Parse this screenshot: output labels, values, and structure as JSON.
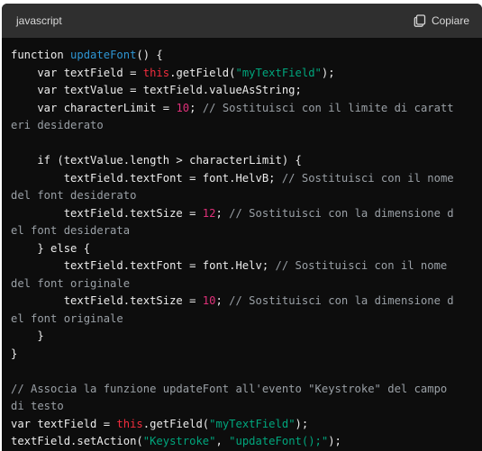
{
  "header": {
    "language": "javascript",
    "copy_label": "Copiare",
    "copy_icon": "clipboard-icon"
  },
  "colors": {
    "background": "#0d0d0d",
    "header_bg": "#2f2f2f",
    "plain": "#ececec",
    "function_name": "#2e95d3",
    "string": "#00a67d",
    "number": "#df3079",
    "comment": "#9aa0a6",
    "keyword_this": "#f22c3d"
  },
  "code_lines": [
    [
      [
        "plain",
        "function "
      ],
      [
        "fn",
        "updateFont"
      ],
      [
        "plain",
        "() {"
      ]
    ],
    [
      [
        "plain",
        "    var textField = "
      ],
      [
        "kw",
        "this"
      ],
      [
        "plain",
        ".getField("
      ],
      [
        "str",
        "\"myTextField\""
      ],
      [
        "plain",
        ");"
      ]
    ],
    [
      [
        "plain",
        "    var textValue = textField.valueAsString;"
      ]
    ],
    [
      [
        "plain",
        "    var characterLimit = "
      ],
      [
        "num",
        "10"
      ],
      [
        "plain",
        "; "
      ],
      [
        "com",
        "// Sostituisci con il limite di caratt"
      ]
    ],
    [
      [
        "com",
        "eri desiderato"
      ]
    ],
    [
      [
        "plain",
        ""
      ]
    ],
    [
      [
        "plain",
        "    if (textValue.length > characterLimit) {"
      ]
    ],
    [
      [
        "plain",
        "        textField.textFont = font.HelvB; "
      ],
      [
        "com",
        "// Sostituisci con il nome"
      ]
    ],
    [
      [
        "com",
        "del font desiderato"
      ]
    ],
    [
      [
        "plain",
        "        textField.textSize = "
      ],
      [
        "num",
        "12"
      ],
      [
        "plain",
        "; "
      ],
      [
        "com",
        "// Sostituisci con la dimensione d"
      ]
    ],
    [
      [
        "com",
        "el font desiderata"
      ]
    ],
    [
      [
        "plain",
        "    } else {"
      ]
    ],
    [
      [
        "plain",
        "        textField.textFont = font.Helv; "
      ],
      [
        "com",
        "// Sostituisci con il nome"
      ]
    ],
    [
      [
        "com",
        "del font originale"
      ]
    ],
    [
      [
        "plain",
        "        textField.textSize = "
      ],
      [
        "num",
        "10"
      ],
      [
        "plain",
        "; "
      ],
      [
        "com",
        "// Sostituisci con la dimensione d"
      ]
    ],
    [
      [
        "com",
        "el font originale"
      ]
    ],
    [
      [
        "plain",
        "    }"
      ]
    ],
    [
      [
        "plain",
        "}"
      ]
    ],
    [
      [
        "plain",
        ""
      ]
    ],
    [
      [
        "com",
        "// Associa la funzione updateFont all'evento \"Keystroke\" del campo"
      ]
    ],
    [
      [
        "com",
        "di testo"
      ]
    ],
    [
      [
        "plain",
        "var textField = "
      ],
      [
        "kw",
        "this"
      ],
      [
        "plain",
        ".getField("
      ],
      [
        "str",
        "\"myTextField\""
      ],
      [
        "plain",
        ");"
      ]
    ],
    [
      [
        "plain",
        "textField.setAction("
      ],
      [
        "str",
        "\"Keystroke\""
      ],
      [
        "plain",
        ", "
      ],
      [
        "str",
        "\"updateFont();\""
      ],
      [
        "plain",
        ");"
      ]
    ]
  ]
}
